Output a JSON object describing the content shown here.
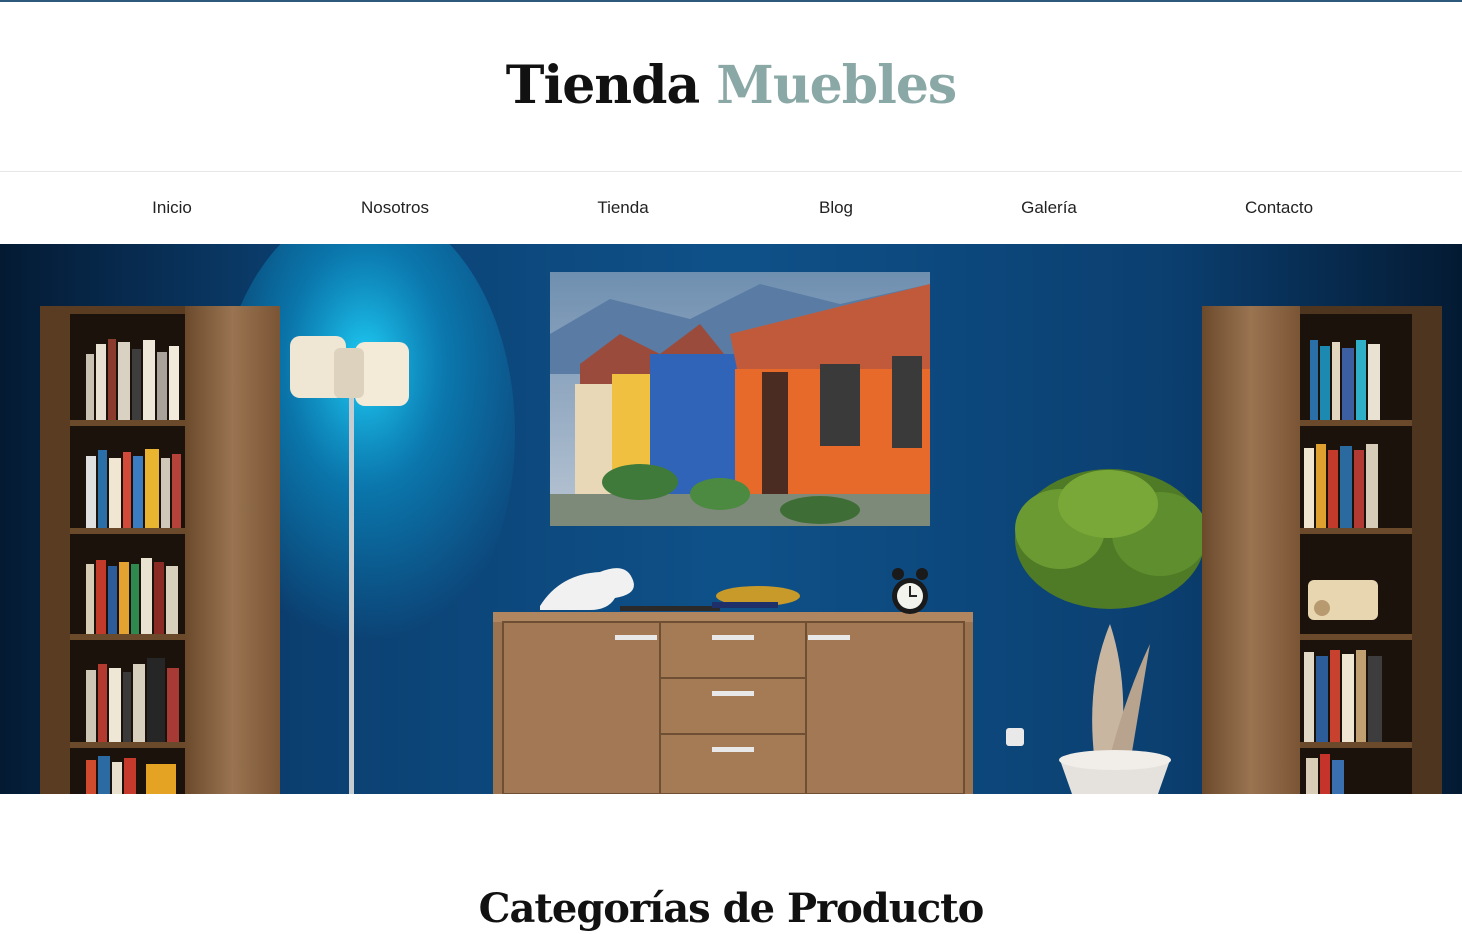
{
  "site": {
    "title_primary": "Tienda",
    "title_accent": "Muebles",
    "accent_color": "#8aa8a6",
    "top_bar_color": "#2d5a7b"
  },
  "nav": {
    "items": [
      {
        "label": "Inicio"
      },
      {
        "label": "Nosotros"
      },
      {
        "label": "Tienda"
      },
      {
        "label": "Blog"
      },
      {
        "label": "Galería"
      },
      {
        "label": "Contacto"
      }
    ]
  },
  "hero": {
    "wall_color": "#0d4e86"
  },
  "sections": {
    "categories_title": "Categorías de Producto"
  }
}
